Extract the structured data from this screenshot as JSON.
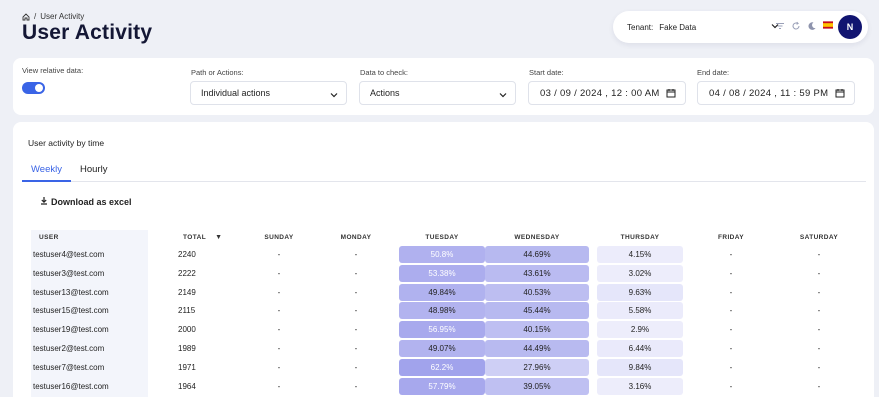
{
  "breadcrumb": {
    "home_icon": "home-icon",
    "separator": "/",
    "current": "User Activity"
  },
  "page": {
    "title": "User Activity"
  },
  "header": {
    "tenant_label": "Tenant:",
    "tenant_value": "Fake Data",
    "icons": [
      "filter-icon",
      "refresh-icon",
      "moon-icon",
      "spain-flag-icon"
    ],
    "avatar_initial": "N"
  },
  "filters": {
    "relative_label": "View relative data:",
    "relative_on": true,
    "path_label": "Path or Actions:",
    "path_value": "Individual actions",
    "data_label": "Data to check:",
    "data_value": "Actions",
    "start_label": "Start date:",
    "start_value": "03 / 09 / 2024 ,  12 : 00   AM",
    "end_label": "End date:",
    "end_value": "04 / 08 / 2024 ,  11 : 59   PM"
  },
  "panel": {
    "title": "User activity by time",
    "tabs": [
      "Weekly",
      "Hourly"
    ],
    "active_tab": "Weekly",
    "download_label": "Download as excel"
  },
  "table": {
    "headers": [
      "USER",
      "TOTAL",
      "SUNDAY",
      "MONDAY",
      "TUESDAY",
      "WEDNESDAY",
      "THURSDAY",
      "FRIDAY",
      "SATURDAY"
    ],
    "sort_indicator": "▼",
    "rows": [
      {
        "user": "testuser4@test.com",
        "total": "2240",
        "sun": "-",
        "mon": "-",
        "tue": "50.8%",
        "wed": "44.69%",
        "thu": "4.15%",
        "fri": "-",
        "sat": "-"
      },
      {
        "user": "testuser3@test.com",
        "total": "2222",
        "sun": "-",
        "mon": "-",
        "tue": "53.38%",
        "wed": "43.61%",
        "thu": "3.02%",
        "fri": "-",
        "sat": "-"
      },
      {
        "user": "testuser13@test.com",
        "total": "2149",
        "sun": "-",
        "mon": "-",
        "tue": "49.84%",
        "wed": "40.53%",
        "thu": "9.63%",
        "fri": "-",
        "sat": "-"
      },
      {
        "user": "testuser15@test.com",
        "total": "2115",
        "sun": "-",
        "mon": "-",
        "tue": "48.98%",
        "wed": "45.44%",
        "thu": "5.58%",
        "fri": "-",
        "sat": "-"
      },
      {
        "user": "testuser19@test.com",
        "total": "2000",
        "sun": "-",
        "mon": "-",
        "tue": "56.95%",
        "wed": "40.15%",
        "thu": "2.9%",
        "fri": "-",
        "sat": "-"
      },
      {
        "user": "testuser2@test.com",
        "total": "1989",
        "sun": "-",
        "mon": "-",
        "tue": "49.07%",
        "wed": "44.49%",
        "thu": "6.44%",
        "fri": "-",
        "sat": "-"
      },
      {
        "user": "testuser7@test.com",
        "total": "1971",
        "sun": "-",
        "mon": "-",
        "tue": "62.2%",
        "wed": "27.96%",
        "thu": "9.84%",
        "fri": "-",
        "sat": "-"
      },
      {
        "user": "testuser16@test.com",
        "total": "1964",
        "sun": "-",
        "mon": "-",
        "tue": "57.79%",
        "wed": "39.05%",
        "thu": "3.16%",
        "fri": "-",
        "sat": "-"
      }
    ]
  },
  "colors": {
    "accent": "#3a64e6",
    "avatar": "#111470",
    "heat_base": "#8f91e8"
  }
}
